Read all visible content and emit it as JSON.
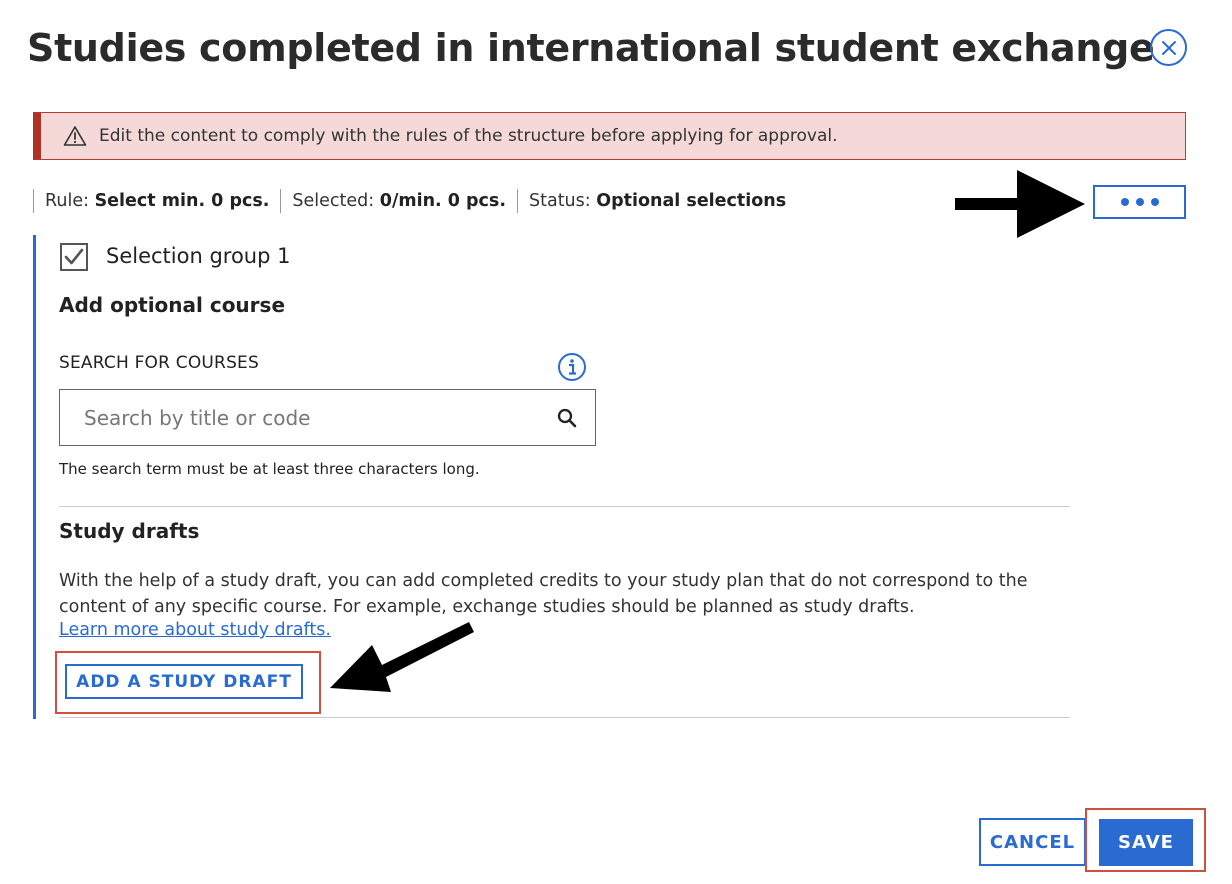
{
  "modal": {
    "title": "Studies completed in international student exchange",
    "close_icon": "close-icon"
  },
  "alert": {
    "icon": "warning-icon",
    "text": "Edit the content to comply with the rules of the structure before applying for approval.",
    "colors": {
      "background": "#f5d9d9",
      "border": "#b03226"
    }
  },
  "rule_bar": {
    "rule_label": "Rule:",
    "rule_value": "Select min. 0 pcs.",
    "selected_label": "Selected:",
    "selected_value": "0/min. 0 pcs.",
    "status_label": "Status:",
    "status_value": "Optional selections",
    "more_icon": "more-options-icon"
  },
  "group": {
    "checked": true,
    "label": "Selection group 1"
  },
  "add_course": {
    "heading": "Add optional course",
    "search_label": "SEARCH FOR COURSES",
    "info_icon": "info-icon",
    "search_placeholder": "Search by title or code",
    "search_value": "",
    "search_icon": "search-icon",
    "hint": "The search term must be at least three characters long."
  },
  "drafts": {
    "heading": "Study drafts",
    "description": "With the help of a study draft, you can add completed credits to your study plan that do not correspond to the content of any specific course. For example, exchange studies should be planned as study drafts.",
    "link": "Learn more about study drafts.",
    "add_button": "ADD A STUDY DRAFT"
  },
  "footer": {
    "cancel": "CANCEL",
    "save": "SAVE"
  },
  "colors": {
    "accent": "#2a6bd1",
    "annotation_red": "#d0503f"
  }
}
